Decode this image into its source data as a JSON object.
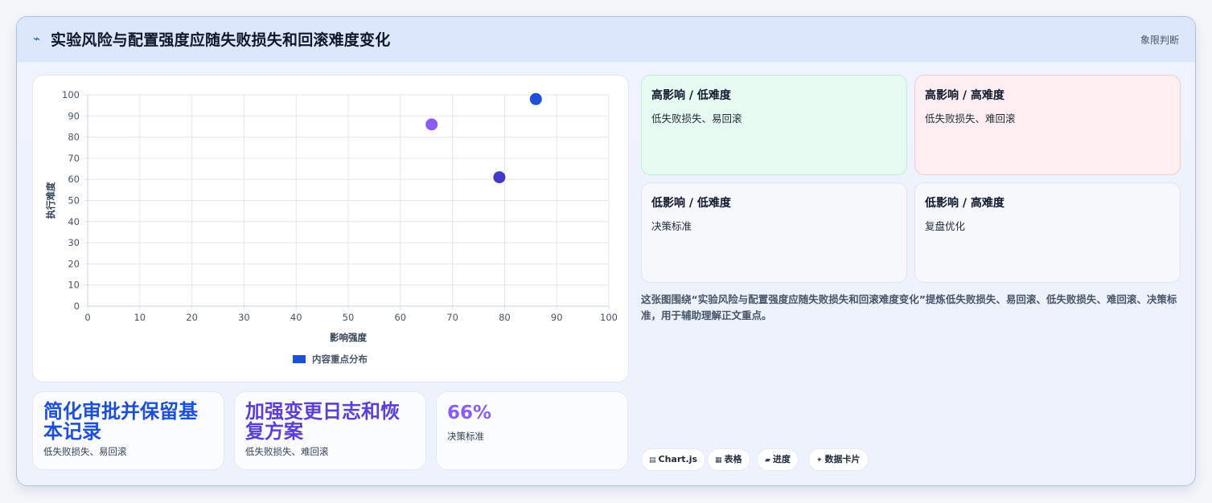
{
  "header": {
    "icon": "lightning-icon",
    "title": "实验风险与配置强度应随失败损失和回滚难度变化",
    "tag": "象限判断"
  },
  "chart_data": {
    "type": "scatter",
    "xlabel": "影响强度",
    "ylabel": "执行难度",
    "xlim": [
      0,
      100
    ],
    "ylim": [
      0,
      100
    ],
    "xticks": [
      0,
      10,
      20,
      30,
      40,
      50,
      60,
      70,
      80,
      90,
      100
    ],
    "yticks": [
      0,
      10,
      20,
      30,
      40,
      50,
      60,
      70,
      80,
      90,
      100
    ],
    "grid": true,
    "legend": "bottom",
    "series": [
      {
        "name": "内容重点分布",
        "color": "#1d4fd8",
        "points": [
          {
            "x": 86,
            "y": 98,
            "color": "#1d4fd8"
          },
          {
            "x": 66,
            "y": 86,
            "color": "#8b5cf6"
          },
          {
            "x": 79,
            "y": 61,
            "color": "#4338ca"
          }
        ]
      }
    ]
  },
  "quadrants": [
    {
      "title": "高影响 / 低难度",
      "desc": "低失败损失、易回滚"
    },
    {
      "title": "高影响 / 高难度",
      "desc": "低失败损失、难回滚"
    },
    {
      "title": "低影响 / 低难度",
      "desc": "决策标准"
    },
    {
      "title": "低影响 / 高难度",
      "desc": "复盘优化"
    }
  ],
  "description": "这张图围绕“实验风险与配置强度应随失败损失和回滚难度变化”提炼低失败损失、易回滚、低失败损失、难回滚、决策标准，用于辅助理解正文重点。",
  "stats": [
    {
      "big": "简化审批并保留基本记录",
      "small": "低失败损失、易回滚"
    },
    {
      "big": "加强变更日志和恢复方案",
      "small": "低失败损失、难回滚"
    },
    {
      "big": "66%",
      "small": "决策标准"
    }
  ],
  "chips": [
    {
      "icon": "chart-icon",
      "glyph": "▤",
      "label": "Chart.js"
    },
    {
      "icon": "table-icon",
      "glyph": "▦",
      "label": "表格"
    },
    {
      "icon": "progress-icon",
      "glyph": "▰",
      "label": "进度"
    },
    {
      "icon": "sparkle-icon",
      "glyph": "✦",
      "label": "数据卡片"
    }
  ]
}
